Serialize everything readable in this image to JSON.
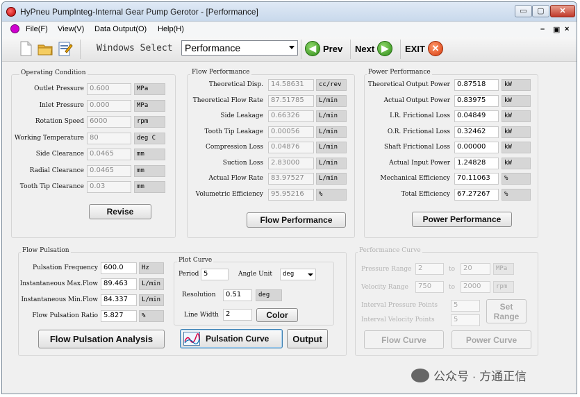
{
  "window": {
    "title": "HyPneu PumpInteg-Internal Gear Pump Gerotor - [Performance]",
    "btn_min": "▭",
    "btn_max": "▢",
    "btn_close": "✕"
  },
  "menu": {
    "items": [
      "File(F)",
      "View(V)",
      "Data Output(O)",
      "Help(H)"
    ],
    "right_controls": [
      "–",
      "▣",
      "×"
    ]
  },
  "toolbar": {
    "windows_select_label": "Windows Select",
    "windows_select_value": "Performance",
    "prev_label": "Prev",
    "next_label": "Next",
    "exit_label": "EXIT",
    "icons": [
      "new-file-icon",
      "open-folder-icon",
      "save-notepad-icon"
    ]
  },
  "operating": {
    "title": "Operating Condition",
    "rows": [
      {
        "label": "Outlet Pressure",
        "value": "0.600",
        "unit": "MPa"
      },
      {
        "label": "Inlet Pressure",
        "value": "0.000",
        "unit": "MPa"
      },
      {
        "label": "Rotation Speed",
        "value": "6000",
        "unit": "rpm"
      },
      {
        "label": "Working Temperature",
        "value": "80",
        "unit": "deg C"
      },
      {
        "label": "Side Clearance",
        "value": "0.0465",
        "unit": "mm"
      },
      {
        "label": "Radial Clearance",
        "value": "0.0465",
        "unit": "mm"
      },
      {
        "label": "Tooth Tip Clearance",
        "value": "0.03",
        "unit": "mm"
      }
    ],
    "button": "Revise"
  },
  "flow": {
    "title": "Flow Performance",
    "rows": [
      {
        "label": "Theoretical Disp.",
        "value": "14.58631",
        "unit": "cc/rev"
      },
      {
        "label": "Theoretical Flow Rate",
        "value": "87.51785",
        "unit": "L/min"
      },
      {
        "label": "Side Leakage",
        "value": "0.66326",
        "unit": "L/min"
      },
      {
        "label": "Tooth Tip Leakage",
        "value": "0.00056",
        "unit": "L/min"
      },
      {
        "label": "Compression Loss",
        "value": "0.04876",
        "unit": "L/min"
      },
      {
        "label": "Suction Loss",
        "value": "2.83000",
        "unit": "L/min"
      },
      {
        "label": "Actual Flow Rate",
        "value": "83.97527",
        "unit": "L/min"
      },
      {
        "label": "Volumetric Efficiency",
        "value": "95.95216",
        "unit": "%"
      }
    ],
    "button": "Flow Performance"
  },
  "power": {
    "title": "Power Performance",
    "rows": [
      {
        "label": "Theoretical Output Power",
        "value": "0.87518",
        "unit": "kW"
      },
      {
        "label": "Actual Output Power",
        "value": "0.83975",
        "unit": "kW"
      },
      {
        "label": "I.R. Frictional Loss",
        "value": "0.04849",
        "unit": "kW"
      },
      {
        "label": "O.R. Frictional Loss",
        "value": "0.32462",
        "unit": "kW"
      },
      {
        "label": "Shaft Frictional Loss",
        "value": "0.00000",
        "unit": "kW"
      },
      {
        "label": "Actual Input Power",
        "value": "1.24828",
        "unit": "kW"
      },
      {
        "label": "Mechanical Efficiency",
        "value": "70.11063",
        "unit": "%"
      },
      {
        "label": "Total Efficiency",
        "value": "67.27267",
        "unit": "%"
      }
    ],
    "button": "Power Performance"
  },
  "pulsation": {
    "title": "Flow Pulsation",
    "rows": [
      {
        "label": "Pulsation Frequency",
        "value": "600.0",
        "unit": "Hz"
      },
      {
        "label": "Instantaneous Max.Flow",
        "value": "89.463",
        "unit": "L/min"
      },
      {
        "label": "Instantaneous Min.Flow",
        "value": "84.337",
        "unit": "L/min"
      },
      {
        "label": "Flow Pulsation Ratio",
        "value": "5.827",
        "unit": "%"
      }
    ],
    "button": "Flow Pulsation Analysis"
  },
  "plot_curve": {
    "title": "Plot Curve",
    "period_label": "Period",
    "period_value": "5",
    "angle_unit_label": "Angle Unit",
    "angle_unit_value": "deg",
    "resolution_label": "Resolution",
    "resolution_value": "0.51",
    "resolution_unit": "deg",
    "line_width_label": "Line Width",
    "line_width_value": "2",
    "color_button": "Color",
    "pulsation_curve_button": "Pulsation Curve",
    "output_button": "Output"
  },
  "perf_curve": {
    "title": "Performance Curve",
    "pressure_range_label": "Pressure Range",
    "pressure_from": "2",
    "pressure_to": "20",
    "pressure_unit": "MPa",
    "velocity_range_label": "Velocity Range",
    "velocity_from": "750",
    "velocity_to": "2000",
    "velocity_unit": "rpm",
    "to_label": "to",
    "interval_pressure_label": "Interval Pressure Points",
    "interval_pressure_value": "5",
    "interval_velocity_label": "Interval Velocity Points",
    "interval_velocity_value": "5",
    "set_range_button": "Set Range",
    "flow_curve_button": "Flow Curve",
    "power_curve_button": "Power Curve"
  },
  "watermark": {
    "logo": "微信",
    "text": "公众号 · 方通正信"
  }
}
